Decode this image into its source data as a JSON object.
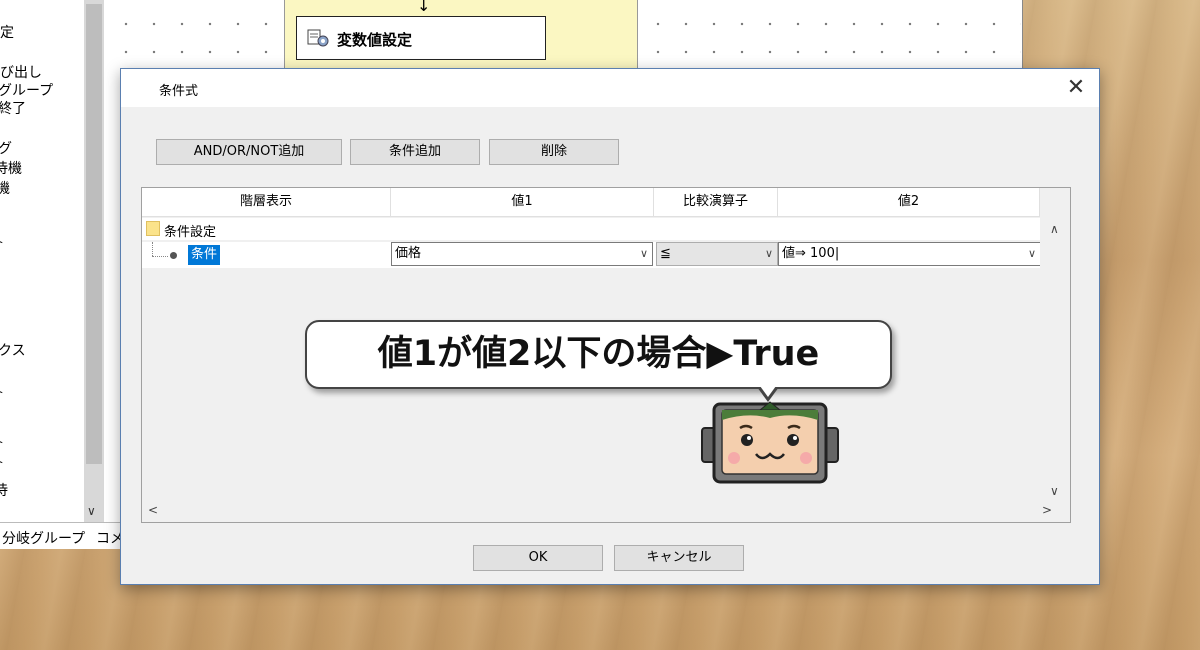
{
  "background_app": {
    "sidebar_items": [
      "定",
      "呼び出し",
      "グループ",
      "終了",
      "グ",
      "待機",
      "機",
      "ト",
      "クス",
      "ト",
      "ト",
      "ト",
      "待"
    ],
    "footer_tabs": [
      "分岐グループ",
      "コメ"
    ],
    "flow_node_label": "変数値設定"
  },
  "dialog": {
    "title": "条件式",
    "close_glyph": "✕",
    "buttons": {
      "add_logic": "AND/OR/NOT追加",
      "add_condition": "条件追加",
      "delete": "削除",
      "ok": "OK",
      "cancel": "キャンセル"
    },
    "grid": {
      "columns": [
        "階層表示",
        "値1",
        "比較演算子",
        "値2"
      ],
      "root_node": "条件設定",
      "child_node": "条件",
      "value1": "価格",
      "operator": "≦",
      "value2": "値⇒ 100|"
    }
  },
  "annotation": {
    "bubble_text": "値1が値2以下の場合▶True"
  },
  "icons": [
    "close-icon",
    "folder-icon",
    "chevron-down-icon",
    "chevron-up-icon",
    "chevron-left-icon",
    "chevron-right-icon",
    "flow-arrow-icon",
    "mascot-robot"
  ]
}
